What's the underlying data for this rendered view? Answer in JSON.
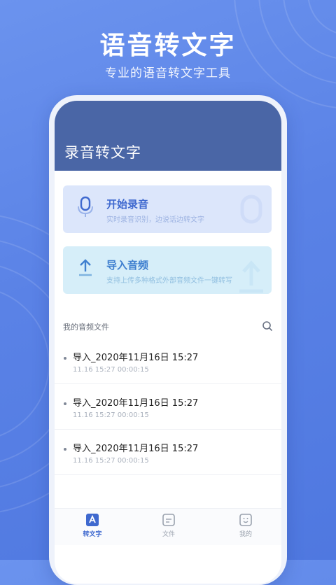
{
  "hero": {
    "title": "语音转文字",
    "subtitle": "专业的语音转文字工具"
  },
  "app": {
    "title": "录音转文字"
  },
  "actions": {
    "record": {
      "title": "开始录音",
      "subtitle": "实时录音识别，边说话边转文字",
      "icon": "microphone-icon"
    },
    "import": {
      "title": "导入音频",
      "subtitle": "支持上传多种格式外部音频文件一键转写",
      "icon": "upload-icon"
    }
  },
  "files": {
    "section_label": "我的音频文件",
    "search_icon": "search-icon",
    "items": [
      {
        "name": "导入_2020年11月16日  15:27",
        "meta": "11.16 15:27 00:00:15"
      },
      {
        "name": "导入_2020年11月16日  15:27",
        "meta": "11.16 15:27 00:00:15"
      },
      {
        "name": "导入_2020年11月16日  15:27",
        "meta": "11.16 15:27 00:00:15"
      }
    ]
  },
  "tabs": [
    {
      "label": "转文字",
      "icon": "text-convert-icon",
      "active": true
    },
    {
      "label": "文件",
      "icon": "file-icon",
      "active": false
    },
    {
      "label": "我的",
      "icon": "profile-icon",
      "active": false
    }
  ],
  "colors": {
    "background": "#5a82e6",
    "header": "#4a66a6",
    "accent": "#3f69cf",
    "record_card": "#dce6fb",
    "import_card": "#d6eef9"
  }
}
